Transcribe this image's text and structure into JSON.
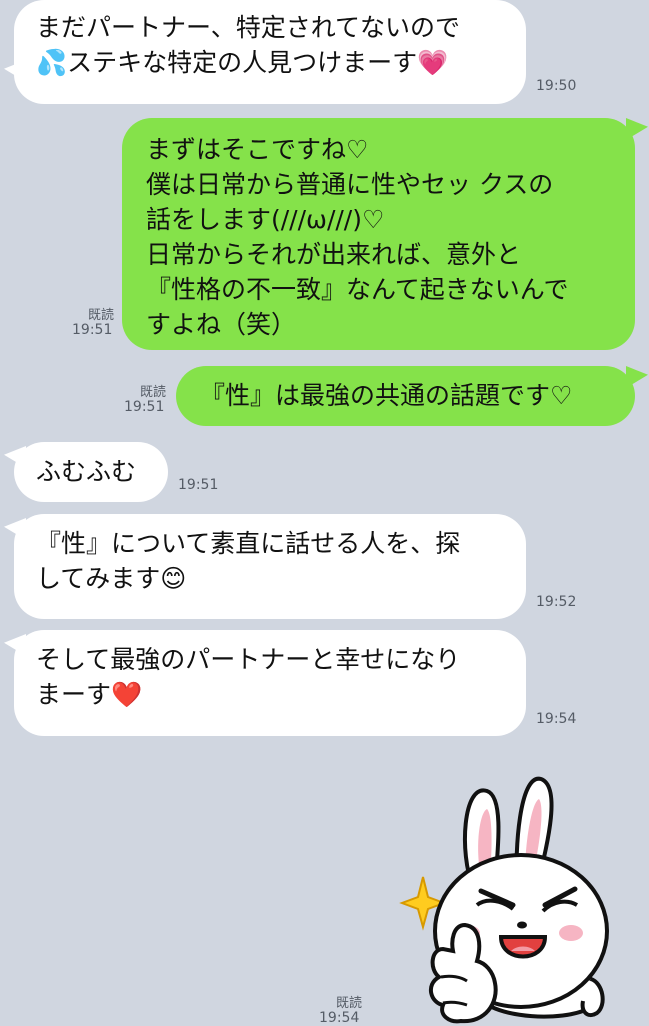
{
  "messages": [
    {
      "side": "in",
      "text": "まだパートナー、特定されてないので\n💦ステキな特定の人見つけまーす💗",
      "time": "19:50"
    },
    {
      "side": "out",
      "text": "まずはそこですね♡\n僕は日常から普通に性やセッ クスの\n話をします(///ω///)♡\n日常からそれが出来れば、意外と\n『性格の不一致』なんて起きないんで\nすよね（笑）",
      "read": "既読",
      "time": "19:51"
    },
    {
      "side": "out",
      "text": "『性』は最強の共通の話題です♡",
      "read": "既読",
      "time": "19:51"
    },
    {
      "side": "in",
      "text": "ふむふむ",
      "time": "19:51"
    },
    {
      "side": "in",
      "text": "『性』について素直に話せる人を、探\nしてみます😊",
      "time": "19:52"
    },
    {
      "side": "in",
      "text": "そして最強のパートナーと幸せになり\nまーす❤️",
      "time": "19:54"
    }
  ],
  "sticker": {
    "name": "cony-thumbs-up-sticker",
    "read": "既読",
    "time": "19:54"
  }
}
